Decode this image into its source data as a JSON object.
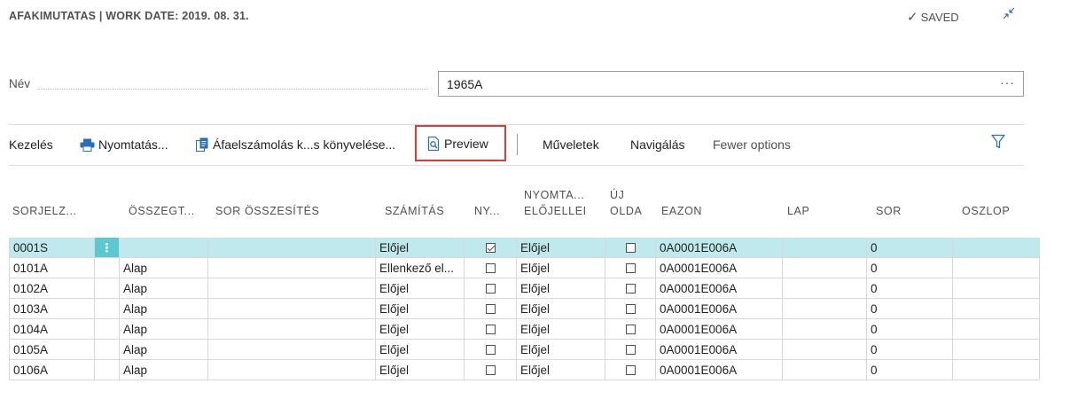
{
  "header": {
    "title": "AFAKIMUTATAS | WORK DATE: 2019. 08. 31.",
    "saved_label": "SAVED"
  },
  "name_field": {
    "label": "Név",
    "value": "1965A",
    "more": "···"
  },
  "actions": {
    "kezeles": "Kezelés",
    "nyomtatas": "Nyomtatás...",
    "afaelszamolas": "Áfaelszámolás k...s könyvelése...",
    "preview": "Preview",
    "muveletek": "Műveletek",
    "navigalas": "Navigálás",
    "fewer_options": "Fewer options"
  },
  "table": {
    "headers": {
      "sorjelzo": "SORJELZ...",
      "osszeg": "ÖSSZEGT...",
      "sor_osszesites": "SOR ÖSSZESÍTÉS",
      "szamitas": "SZÁMÍTÁS",
      "ny": "NY...",
      "nyomtatas_line1": "NYOMTA...",
      "nyomtatas_line2": "ELŐJELLEI",
      "uj_line1": "ÚJ",
      "uj_line2": "OLDA",
      "eazon": "EAZON",
      "lap": "LAP",
      "sor": "SOR",
      "oszlop": "OSZLOP"
    },
    "rows": [
      {
        "sorjelzo": "0001S",
        "dots": "⋮",
        "osszeg": "",
        "sor_osszesites": "",
        "szamitas": "Előjel",
        "ny": true,
        "elojel": "Előjel",
        "uj": false,
        "eazon": "0A0001E006A",
        "lap": "",
        "sor": "0",
        "oszlop": ""
      },
      {
        "sorjelzo": "0101A",
        "dots": "",
        "osszeg": "Alap",
        "sor_osszesites": "",
        "szamitas": "Ellenkező el...",
        "ny": false,
        "elojel": "Előjel",
        "uj": false,
        "eazon": "0A0001E006A",
        "lap": "",
        "sor": "0",
        "oszlop": ""
      },
      {
        "sorjelzo": "0102A",
        "dots": "",
        "osszeg": "Alap",
        "sor_osszesites": "",
        "szamitas": "Előjel",
        "ny": false,
        "elojel": "Előjel",
        "uj": false,
        "eazon": "0A0001E006A",
        "lap": "",
        "sor": "0",
        "oszlop": ""
      },
      {
        "sorjelzo": "0103A",
        "dots": "",
        "osszeg": "Alap",
        "sor_osszesites": "",
        "szamitas": "Előjel",
        "ny": false,
        "elojel": "Előjel",
        "uj": false,
        "eazon": "0A0001E006A",
        "lap": "",
        "sor": "0",
        "oszlop": ""
      },
      {
        "sorjelzo": "0104A",
        "dots": "",
        "osszeg": "Alap",
        "sor_osszesites": "",
        "szamitas": "Előjel",
        "ny": false,
        "elojel": "Előjel",
        "uj": false,
        "eazon": "0A0001E006A",
        "lap": "",
        "sor": "0",
        "oszlop": ""
      },
      {
        "sorjelzo": "0105A",
        "dots": "",
        "osszeg": "Alap",
        "sor_osszesites": "",
        "szamitas": "Előjel",
        "ny": false,
        "elojel": "Előjel",
        "uj": false,
        "eazon": "0A0001E006A",
        "lap": "",
        "sor": "0",
        "oszlop": ""
      },
      {
        "sorjelzo": "0106A",
        "dots": "",
        "osszeg": "Alap",
        "sor_osszesites": "",
        "szamitas": "Előjel",
        "ny": false,
        "elojel": "Előjel",
        "uj": false,
        "eazon": "0A0001E006A",
        "lap": "",
        "sor": "0",
        "oszlop": ""
      }
    ],
    "selected_row": 0
  },
  "colors": {
    "accent": "#2a6ebb",
    "selected_row": "#bfe9ec",
    "selected_handle": "#5cc9d1",
    "highlight_border": "#d83b3b"
  },
  "icons": {
    "saved": "check-icon",
    "collapse": "collapse-icon",
    "print": "printer-icon",
    "post": "document-post-icon",
    "preview": "preview-icon",
    "filter": "filter-icon"
  }
}
